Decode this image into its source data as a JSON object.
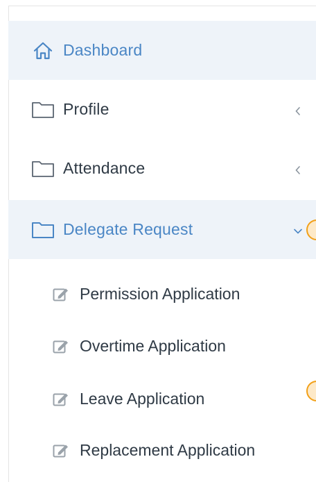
{
  "sidebar": {
    "items": [
      {
        "label": "Dashboard",
        "icon": "home-icon"
      },
      {
        "label": "Profile",
        "icon": "folder-icon",
        "chevron": "chevron-left-icon"
      },
      {
        "label": "Attendance",
        "icon": "folder-icon",
        "chevron": "chevron-left-icon"
      },
      {
        "label": "Delegate Request",
        "icon": "folder-icon",
        "chevron": "chevron-down-icon",
        "expanded": true
      }
    ],
    "subitems": [
      {
        "label": "Permission Application",
        "icon": "edit-icon"
      },
      {
        "label": "Overtime Application",
        "icon": "edit-icon"
      },
      {
        "label": "Leave Application",
        "icon": "edit-icon"
      },
      {
        "label": "Replacement Application",
        "icon": "edit-icon"
      }
    ]
  },
  "colors": {
    "accent": "#4a86c5",
    "text": "#2f3a45",
    "active_bg": "#eef3f9",
    "icon_gray": "#8a949e",
    "marker_border": "#f2a018",
    "marker_fill": "#fde9c8"
  }
}
